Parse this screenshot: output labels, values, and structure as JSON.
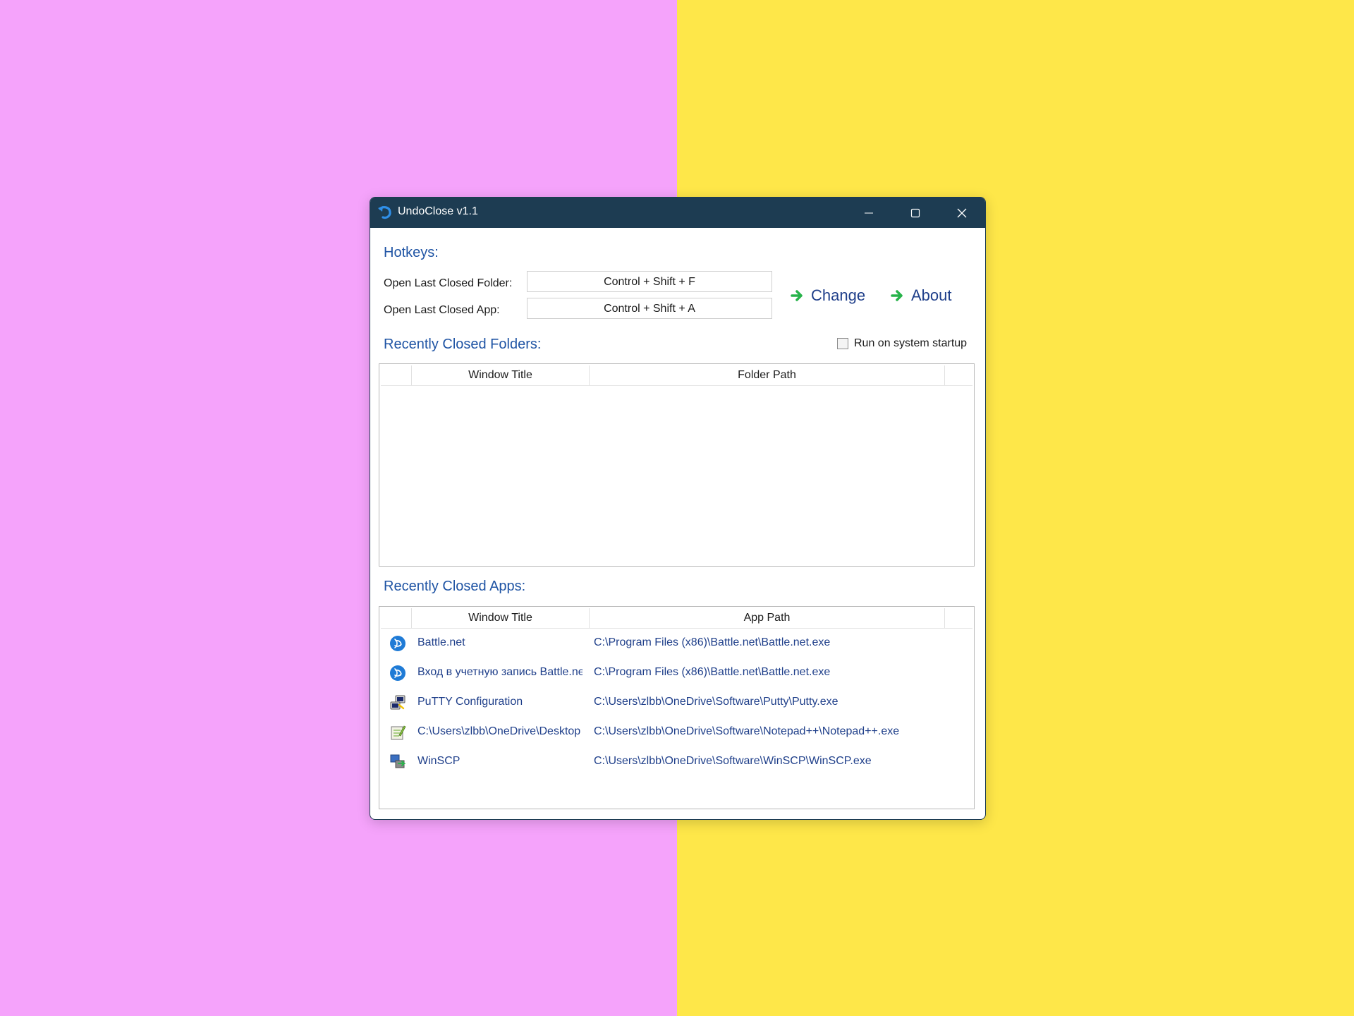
{
  "colors": {
    "background_left": "#f5a3fb",
    "background_right": "#fee749",
    "titlebar": "#1d3c52",
    "heading_blue": "#1f54a4",
    "link_blue": "#1f3f8a",
    "arrow_green": "#27b34a",
    "battle_blue": "#1f7bd6"
  },
  "window": {
    "title": "UndoClose v1.1",
    "app_icon": "undo-arrow-icon",
    "controls": {
      "minimize": "minimize-icon",
      "maximize": "maximize-icon",
      "close": "close-icon"
    }
  },
  "hotkeys": {
    "heading": "Hotkeys:",
    "folder_label": "Open Last Closed Folder:",
    "folder_value": "Control + Shift + F",
    "app_label": "Open Last Closed App:",
    "app_value": "Control + Shift + A",
    "change_label": "Change",
    "about_label": "About"
  },
  "startup": {
    "label": "Run on system startup",
    "checked": false
  },
  "folders": {
    "heading": "Recently Closed Folders:",
    "columns": [
      "Window Title",
      "Folder Path"
    ],
    "rows": []
  },
  "apps": {
    "heading": "Recently Closed Apps:",
    "columns": [
      "Window Title",
      "App Path"
    ],
    "rows": [
      {
        "icon": "battlenet-icon",
        "title": "Battle.net",
        "path": "C:\\Program Files (x86)\\Battle.net\\Battle.net.exe"
      },
      {
        "icon": "battlenet-icon",
        "title": "Вход в учетную запись Battle.net",
        "path": "C:\\Program Files (x86)\\Battle.net\\Battle.net.exe"
      },
      {
        "icon": "putty-icon",
        "title": "PuTTY Configuration",
        "path": "C:\\Users\\zlbb\\OneDrive\\Software\\Putty\\Putty.exe"
      },
      {
        "icon": "notepadpp-icon",
        "title": "C:\\Users\\zlbb\\OneDrive\\Desktop",
        "path": "C:\\Users\\zlbb\\OneDrive\\Software\\Notepad++\\Notepad++.exe"
      },
      {
        "icon": "winscp-icon",
        "title": "WinSCP",
        "path": "C:\\Users\\zlbb\\OneDrive\\Software\\WinSCP\\WinSCP.exe"
      }
    ]
  }
}
